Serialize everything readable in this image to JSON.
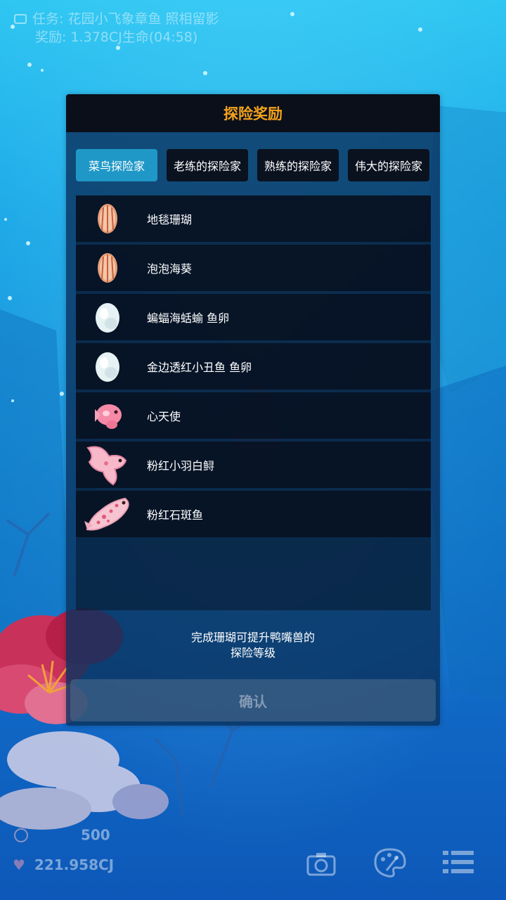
{
  "hud": {
    "task": "任务: 花园小飞象章鱼 照相留影",
    "reward": "奖励: 1.378CJ生命(04:58)",
    "score": "500",
    "currency": "221.958CJ"
  },
  "dialog": {
    "title": "探险奖励",
    "tabs": [
      {
        "label": "菜鸟探险家",
        "active": true
      },
      {
        "label": "老练的探险家",
        "active": false
      },
      {
        "label": "熟练的探险家",
        "active": false
      },
      {
        "label": "伟大的探险家",
        "active": false
      }
    ],
    "items": [
      {
        "name": "地毯珊瑚",
        "icon": "shell-icon"
      },
      {
        "name": "泡泡海葵",
        "icon": "shell-icon"
      },
      {
        "name": "蝙蝠海蛞蝓 鱼卵",
        "icon": "egg-icon"
      },
      {
        "name": "金边透红小丑鱼 鱼卵",
        "icon": "egg-icon"
      },
      {
        "name": "心天使",
        "icon": "pink-fish-icon"
      },
      {
        "name": "粉红小羽白鲟",
        "icon": "pink-butterfly-fish-icon"
      },
      {
        "name": "粉红石斑鱼",
        "icon": "pink-grouper-icon"
      }
    ],
    "note_line1": "完成珊瑚可提升鸭嘴兽的",
    "note_line2": "探险等级",
    "confirm_label": "确认"
  },
  "colors": {
    "title": "#f4a31c",
    "active_tab": "#1f98c7",
    "tab": "#0a121f"
  }
}
